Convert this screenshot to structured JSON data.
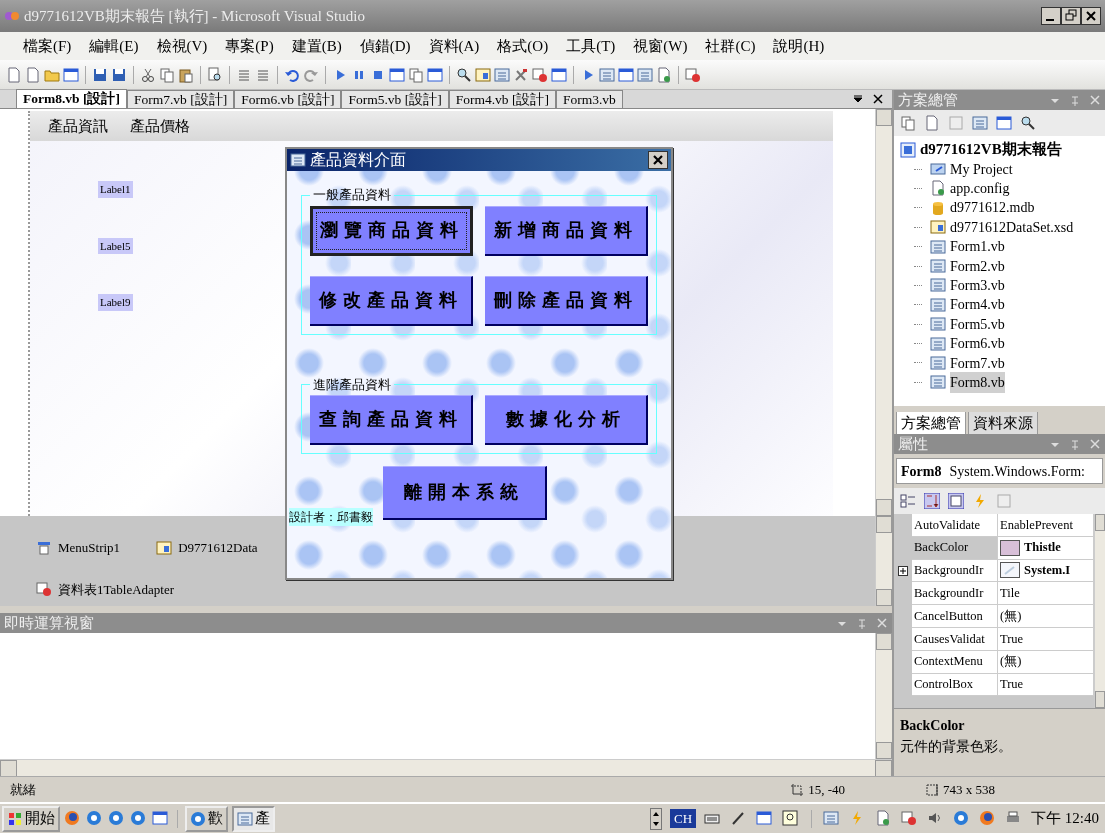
{
  "window": {
    "title": "d9771612VB期末報告 [執行] - Microsoft Visual Studio"
  },
  "menu": [
    "檔案(F)",
    "編輯(E)",
    "檢視(V)",
    "專案(P)",
    "建置(B)",
    "偵錯(D)",
    "資料(A)",
    "格式(O)",
    "工具(T)",
    "視窗(W)",
    "社群(C)",
    "說明(H)"
  ],
  "tabs": [
    {
      "label": "Form8.vb [設計]",
      "selected": true
    },
    {
      "label": "Form7.vb [設計]",
      "selected": false
    },
    {
      "label": "Form6.vb [設計]",
      "selected": false
    },
    {
      "label": "Form5.vb [設計]",
      "selected": false
    },
    {
      "label": "Form4.vb [設計]",
      "selected": false
    },
    {
      "label": "Form3.vb",
      "selected": false
    }
  ],
  "form_designer": {
    "menu": [
      "產品資訊",
      "產品價格"
    ],
    "labels": [
      "Label1",
      "Label5",
      "Label9"
    ]
  },
  "component_tray": [
    {
      "label": "MenuStrip1",
      "kind": "menu"
    },
    {
      "label": "D9771612Data",
      "kind": "dataset"
    },
    {
      "label": "資料表1TableAdapter",
      "kind": "adapter"
    }
  ],
  "dialog": {
    "title": "產品資料介面",
    "groups": [
      {
        "title": "一般產品資料",
        "buttons": [
          {
            "label": "瀏覽商品資料",
            "focused": true
          },
          {
            "label": "新增商品資料",
            "focused": false
          },
          {
            "label": "修改產品資料",
            "focused": false
          },
          {
            "label": "刪除產品資料",
            "focused": false
          }
        ]
      },
      {
        "title": "進階產品資料",
        "buttons": [
          {
            "label": "查詢產品資料",
            "focused": false
          },
          {
            "label": "數據化分析",
            "focused": false
          }
        ]
      }
    ],
    "exit_button": "離開本系統",
    "credit": "設計者：邱書毅"
  },
  "immediate_window": {
    "title": "即時運算視窗"
  },
  "solution_explorer": {
    "title": "方案總管",
    "project": "d9771612VB期末報告",
    "items": [
      {
        "label": "My Project",
        "kind": "myproject",
        "selected": false
      },
      {
        "label": "app.config",
        "kind": "config",
        "selected": false
      },
      {
        "label": "d9771612.mdb",
        "kind": "database",
        "selected": false
      },
      {
        "label": "d9771612DataSet.xsd",
        "kind": "dataset",
        "selected": false
      },
      {
        "label": "Form1.vb",
        "kind": "form",
        "selected": false
      },
      {
        "label": "Form2.vb",
        "kind": "form",
        "selected": false
      },
      {
        "label": "Form3.vb",
        "kind": "form",
        "selected": false
      },
      {
        "label": "Form4.vb",
        "kind": "form",
        "selected": false
      },
      {
        "label": "Form5.vb",
        "kind": "form",
        "selected": false
      },
      {
        "label": "Form6.vb",
        "kind": "form",
        "selected": false
      },
      {
        "label": "Form7.vb",
        "kind": "form",
        "selected": false
      },
      {
        "label": "Form8.vb",
        "kind": "form",
        "selected": true
      }
    ]
  },
  "panel_tabs": [
    {
      "label": "方案總管",
      "selected": true
    },
    {
      "label": "資料來源",
      "selected": false
    }
  ],
  "properties": {
    "title": "屬性",
    "object_name": "Form8",
    "object_type": "System.Windows.Form:",
    "rows": [
      {
        "name": "AutoValidate",
        "value": "EnablePrevent",
        "kind": "text",
        "selected": false,
        "bold": false,
        "expandable": false
      },
      {
        "name": "BackColor",
        "value": "Thistle",
        "kind": "color",
        "color": "#d8bfd8",
        "selected": true,
        "bold": true,
        "expandable": false
      },
      {
        "name": "BackgroundIr",
        "value": "System.I",
        "kind": "image",
        "selected": false,
        "bold": true,
        "expandable": true
      },
      {
        "name": "BackgroundIr",
        "value": "Tile",
        "kind": "text",
        "selected": false,
        "bold": false,
        "expandable": false
      },
      {
        "name": "CancelButton",
        "value": "(無)",
        "kind": "text",
        "selected": false,
        "bold": false,
        "expandable": false
      },
      {
        "name": "CausesValidat",
        "value": "True",
        "kind": "text",
        "selected": false,
        "bold": false,
        "expandable": false
      },
      {
        "name": "ContextMenu",
        "value": "(無)",
        "kind": "text",
        "selected": false,
        "bold": false,
        "expandable": false
      },
      {
        "name": "ControlBox",
        "value": "True",
        "kind": "text",
        "selected": false,
        "bold": false,
        "expandable": false
      }
    ],
    "description_title": "BackColor",
    "description": "元件的背景色彩。"
  },
  "status_bar": {
    "text": "就緒",
    "position": "15, -40",
    "size": "743 x 538"
  },
  "taskbar": {
    "start": "開始",
    "tasks": [
      {
        "label": "歡",
        "selected": false
      },
      {
        "label": "產",
        "selected": true
      }
    ],
    "language": "CH",
    "clock": "下午 12:40"
  }
}
